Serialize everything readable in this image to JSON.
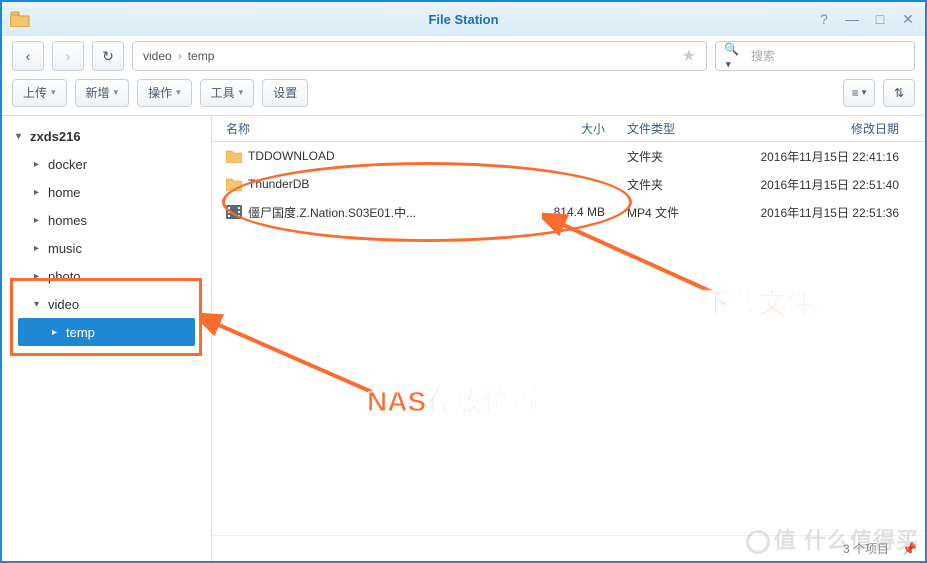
{
  "window": {
    "title": "File Station"
  },
  "nav": {
    "breadcrumb": [
      "video",
      "temp"
    ]
  },
  "search": {
    "placeholder": "搜索"
  },
  "toolbar": {
    "upload": "上传",
    "create": "新增",
    "action": "操作",
    "tools": "工具",
    "settings": "设置"
  },
  "tree": {
    "root": "zxds216",
    "items": [
      {
        "label": "docker",
        "expanded": false
      },
      {
        "label": "home",
        "expanded": false
      },
      {
        "label": "homes",
        "expanded": false
      },
      {
        "label": "music",
        "expanded": false
      },
      {
        "label": "photo",
        "expanded": false
      },
      {
        "label": "video",
        "expanded": true,
        "children": [
          {
            "label": "temp",
            "selected": true
          }
        ]
      }
    ]
  },
  "columns": {
    "name": "名称",
    "size": "大小",
    "type": "文件类型",
    "date": "修改日期"
  },
  "files": [
    {
      "icon": "folder",
      "name": "TDDOWNLOAD",
      "size": "",
      "type": "文件夹",
      "date": "2016年11月15日 22:41:16"
    },
    {
      "icon": "folder",
      "name": "ThunderDB",
      "size": "",
      "type": "文件夹",
      "date": "2016年11月15日 22:51:40"
    },
    {
      "icon": "video",
      "name": "僵尸国度.Z.Nation.S03E01.中...",
      "size": "814.4 MB",
      "type": "MP4 文件",
      "date": "2016年11月15日 22:51:36"
    }
  ],
  "status": {
    "count": "3 个项目"
  },
  "annotations": {
    "label1": "下载文件",
    "label2": "NAS存放位置"
  },
  "watermark": "值 什么值得买"
}
